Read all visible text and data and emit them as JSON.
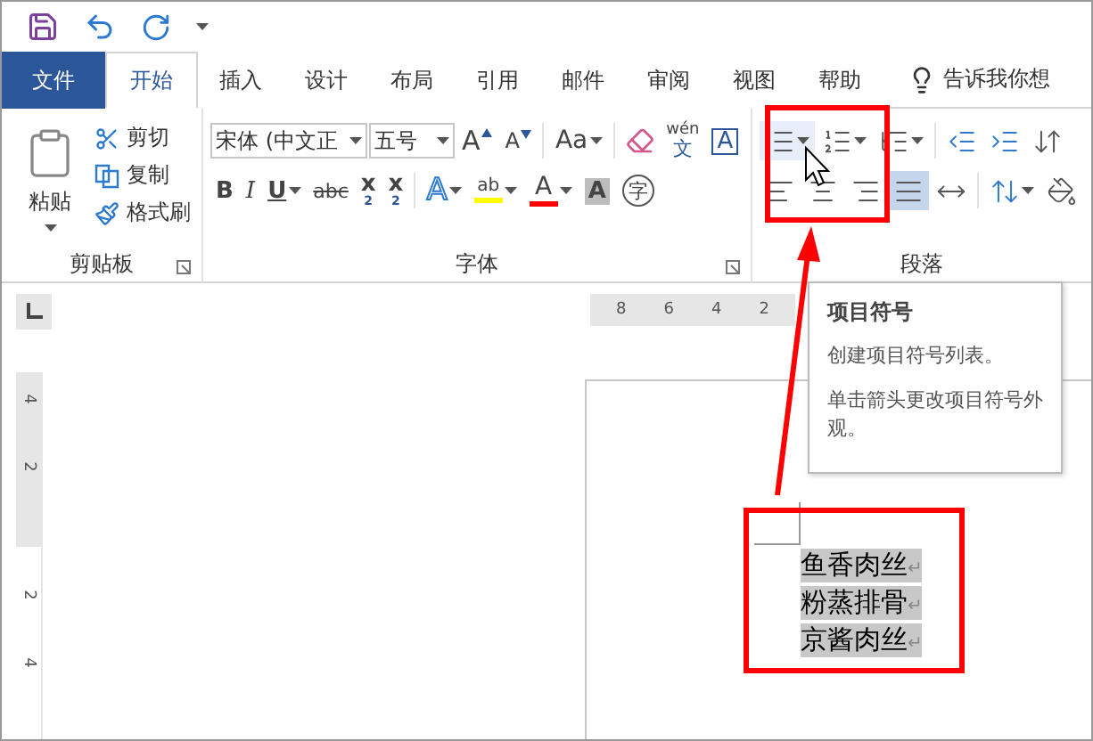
{
  "tabs": [
    {
      "label": "文件",
      "kind": "file",
      "selected": false
    },
    {
      "label": "开始",
      "kind": "tab",
      "selected": true
    },
    {
      "label": "插入",
      "kind": "tab",
      "selected": false
    },
    {
      "label": "设计",
      "kind": "tab",
      "selected": false
    },
    {
      "label": "布局",
      "kind": "tab",
      "selected": false
    },
    {
      "label": "引用",
      "kind": "tab",
      "selected": false
    },
    {
      "label": "邮件",
      "kind": "tab",
      "selected": false
    },
    {
      "label": "审阅",
      "kind": "tab",
      "selected": false
    },
    {
      "label": "视图",
      "kind": "tab",
      "selected": false
    },
    {
      "label": "帮助",
      "kind": "tab",
      "selected": false
    }
  ],
  "tell_me": "告诉我你想",
  "clipboard": {
    "paste": "粘贴",
    "group_label": "剪贴板",
    "actions": [
      {
        "kind": "cut",
        "label": "剪切"
      },
      {
        "kind": "copy",
        "label": "复制"
      },
      {
        "kind": "format-painter",
        "label": "格式刷"
      }
    ]
  },
  "font": {
    "name": "宋体 (中文正",
    "size": "五号",
    "group_label": "字体",
    "row1": [
      {
        "kind": "grow",
        "label": "A",
        "dropdown": false
      },
      {
        "kind": "shrink",
        "label": "A",
        "dropdown": false
      },
      {
        "kind": "case",
        "label": "Aa",
        "dropdown": true
      },
      {
        "kind": "clear",
        "dropdown": false
      },
      {
        "kind": "phonetic",
        "label": "wén",
        "sub": "文",
        "dropdown": false
      },
      {
        "kind": "border",
        "label": "A",
        "dropdown": false
      }
    ],
    "row2": [
      {
        "kind": "bold",
        "label": "B",
        "dropdown": false
      },
      {
        "kind": "italic",
        "label": "I",
        "dropdown": false
      },
      {
        "kind": "underline",
        "label": "U",
        "dropdown": true
      },
      {
        "kind": "strike",
        "label": "abc",
        "dropdown": false
      },
      {
        "kind": "subscript",
        "label": "x",
        "sub": "2",
        "dropdown": false
      },
      {
        "kind": "superscript",
        "label": "x",
        "sup": "2",
        "dropdown": false
      },
      {
        "kind": "effects",
        "label": "A",
        "dropdown": true
      },
      {
        "kind": "highlight",
        "label": "ab",
        "color": "#ffff00",
        "dropdown": true
      },
      {
        "kind": "font-color",
        "label": "A",
        "color": "#ff0000",
        "dropdown": true
      },
      {
        "kind": "shading",
        "label": "A",
        "dropdown": false
      },
      {
        "kind": "enclose",
        "label": "字",
        "dropdown": false
      }
    ]
  },
  "paragraph": {
    "group_label": "段落",
    "row1": [
      {
        "kind": "bullets",
        "hovered": true,
        "dropdown": true
      },
      {
        "kind": "numbering",
        "hovered": false,
        "dropdown": true
      },
      {
        "kind": "multilevel",
        "hovered": false,
        "dropdown": true
      },
      {
        "kind": "outdent",
        "hovered": false,
        "dropdown": false
      },
      {
        "kind": "indent",
        "hovered": false,
        "dropdown": false
      },
      {
        "kind": "sort",
        "hovered": false,
        "dropdown": false
      }
    ],
    "row2": [
      {
        "kind": "align-left",
        "selected": false,
        "dropdown": false
      },
      {
        "kind": "align-center",
        "selected": false,
        "dropdown": false
      },
      {
        "kind": "align-right",
        "selected": false,
        "dropdown": false
      },
      {
        "kind": "justify",
        "selected": true,
        "dropdown": false
      },
      {
        "kind": "distributed",
        "selected": false,
        "dropdown": false
      },
      {
        "kind": "line-spacing",
        "selected": false,
        "dropdown": true
      },
      {
        "kind": "shading",
        "selected": false,
        "dropdown": false
      }
    ]
  },
  "horizontal_ruler": [
    "8",
    "6",
    "4",
    "2"
  ],
  "vertical_ruler": [
    "4",
    "2",
    "2",
    "4"
  ],
  "tooltip": {
    "title": "项目符号",
    "lines": [
      "创建项目符号列表。",
      "单击箭头更改项目符号外观。"
    ]
  },
  "document": {
    "lines": [
      {
        "text": "鱼香肉丝",
        "mark": "↵",
        "selected": true
      },
      {
        "text": "粉蒸排骨",
        "mark": "↵",
        "selected": true
      },
      {
        "text": "京酱肉丝",
        "mark": "↵",
        "selected": true
      }
    ]
  }
}
